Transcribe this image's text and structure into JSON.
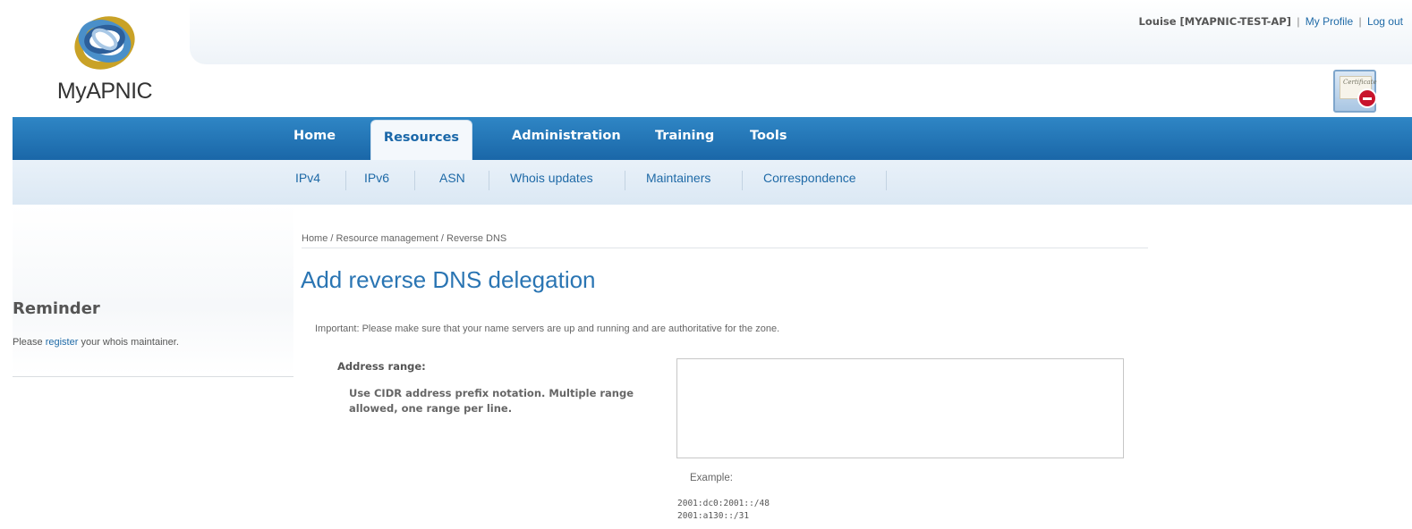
{
  "brand": {
    "logo_text": "MyAPNIC"
  },
  "user_bar": {
    "user": "Louise [MYAPNIC-TEST-AP]",
    "separator": "|",
    "profile_link": "My Profile",
    "logout_link": "Log out"
  },
  "cert_badge": {
    "label": "Certificate"
  },
  "main_nav": {
    "items": [
      {
        "label": "Home"
      },
      {
        "label": "Resources",
        "active": true
      },
      {
        "label": "Administration"
      },
      {
        "label": "Training"
      },
      {
        "label": "Tools"
      }
    ]
  },
  "sub_nav": {
    "items": [
      {
        "label": "IPv4"
      },
      {
        "label": "IPv6"
      },
      {
        "label": "ASN"
      },
      {
        "label": "Whois updates"
      },
      {
        "label": "Maintainers"
      },
      {
        "label": "Correspondence"
      }
    ]
  },
  "sidebar": {
    "reminder_title": "Reminder",
    "reminder_prefix": "Please",
    "reminder_link": "register",
    "reminder_suffix": "your whois maintainer."
  },
  "content": {
    "breadcrumb": "Home / Resource management / Reverse DNS",
    "title": "Add reverse DNS delegation",
    "notice": "Important: Please make sure that your name servers are up and running and are authoritative for the zone.",
    "address_range": {
      "label": "Address range:",
      "help": "Use CIDR address prefix notation. Multiple range allowed, one range per line.",
      "value": "",
      "example_label": "Example:",
      "examples": [
        "2001:dc0:2001::/48",
        "2001:a130::/31"
      ]
    }
  },
  "colors": {
    "nav_blue": "#1a67a8",
    "link_blue": "#1f6aa7",
    "title_blue": "#2a75b3",
    "subnav_bg": "#dbe8f4"
  }
}
